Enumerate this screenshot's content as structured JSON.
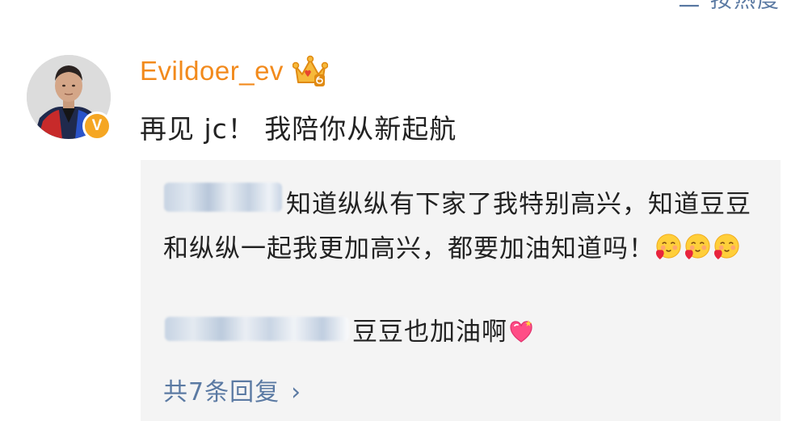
{
  "top_bar": {
    "sort_label": "二 按热度"
  },
  "comment": {
    "username": "Evildoer_ev",
    "vip_icon": "crown-vip-icon",
    "verified_icon": "verified-v-icon",
    "verified_mark": "V",
    "text": "再见 jc！ 我陪你从新起航"
  },
  "replies": {
    "items": [
      {
        "author_blurred": true,
        "text": "知道纵纵有下家了我特别高兴，知道豆豆和纵纵一起我更加高兴，都要加油知道吗！",
        "emoji": [
          "smile-heart-emoji",
          "smile-heart-emoji",
          "smile-heart-emoji"
        ]
      },
      {
        "author_blurred": true,
        "text": "豆豆也加油啊",
        "emoji": [
          "heart-emoji"
        ]
      }
    ],
    "more_label": "共7条回复",
    "more_icon": "chevron-right-icon"
  },
  "colors": {
    "username": "#f28a1c",
    "link": "#5b7aa3",
    "text": "#222222",
    "reply_bg": "#f4f4f4",
    "badge": "#f5a623"
  }
}
